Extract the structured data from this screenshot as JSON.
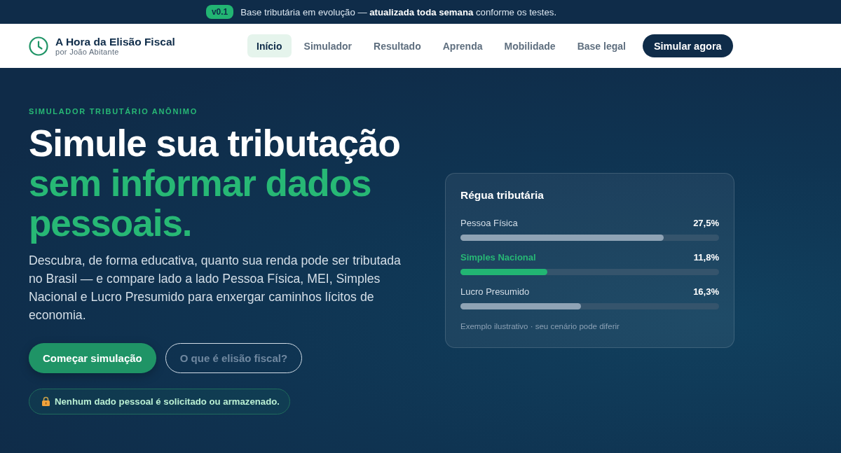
{
  "banner": {
    "badge": "v0.1",
    "message": "Base tributária em evolução — **atualizada toda semana** conforme os testes."
  },
  "header": {
    "brand": {
      "title": "A Hora da Elisão Fiscal",
      "subtitle": "por João Abitante"
    },
    "nav": [
      {
        "label": "Início",
        "selected": true
      },
      {
        "label": "Simulador",
        "selected": false
      },
      {
        "label": "Resultado",
        "selected": false
      },
      {
        "label": "Aprenda",
        "selected": false
      },
      {
        "label": "Mobilidade",
        "selected": false
      },
      {
        "label": "Base legal",
        "selected": false
      }
    ],
    "cta": "Simular agora"
  },
  "hero": {
    "eyebrow": "SIMULADOR TRIBUTÁRIO ANÔNIMO",
    "headline": [
      {
        "text": "Simule sua tributação",
        "accent": false
      },
      {
        "text": "sem informar dados pessoais.",
        "accent": true
      }
    ],
    "description": "Descubra, de forma educativa, quanto sua renda pode ser tributada no Brasil — e compare lado a lado Pessoa Física, MEI, Simples Nacional e Lucro Presumido para enxergar caminhos lícitos de economia.",
    "buttons": [
      {
        "label": "Começar simulação",
        "kind": "primary"
      },
      {
        "label": "O que é elisão fiscal?",
        "kind": "outline"
      }
    ],
    "privacy_note": "Nenhum dado pessoal é solicitado ou armazenado."
  },
  "tax_scale": {
    "title": "Régua tributária",
    "rows": [
      {
        "label": "Pessoa Física",
        "value": "27,5%",
        "level": 0.786,
        "highlighted": false
      },
      {
        "label": "Simples Nacional",
        "value": "11,8%",
        "level": 0.337,
        "highlighted": true
      },
      {
        "label": "Lucro Presumido",
        "value": "16,3%",
        "level": 0.466,
        "highlighted": false
      }
    ],
    "footnote": "Exemplo ilustrativo · seu cenário pode diferir"
  }
}
